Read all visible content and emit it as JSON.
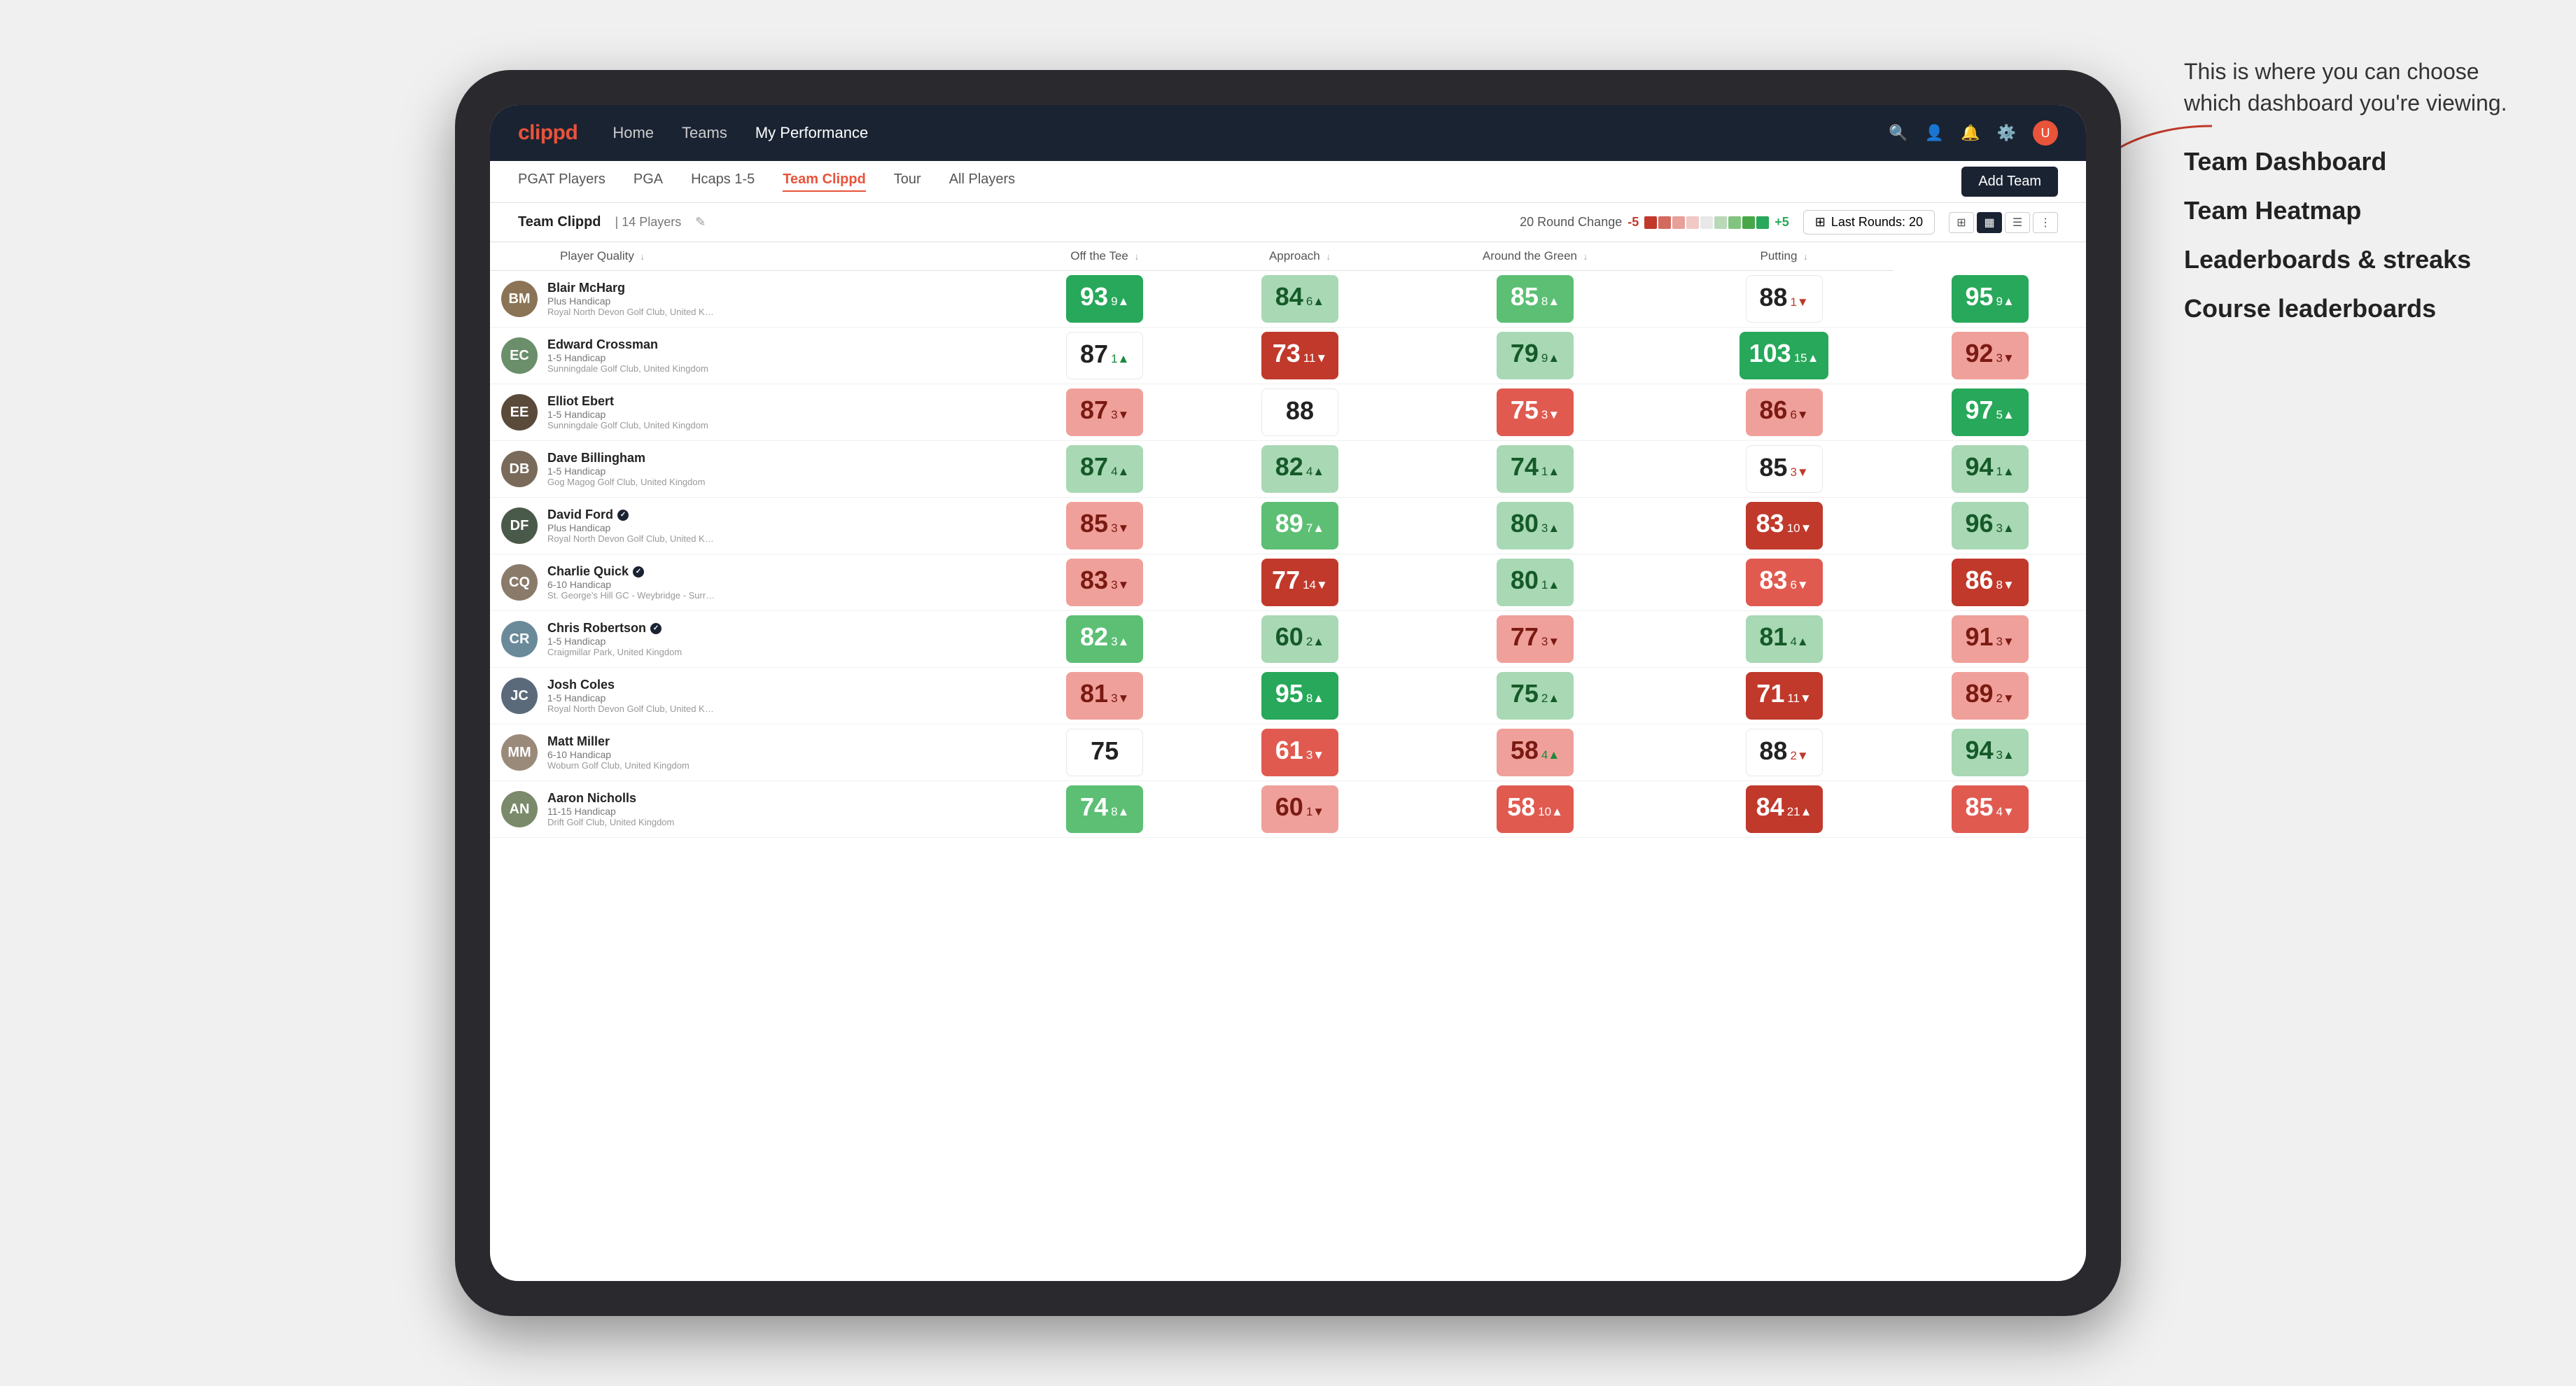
{
  "annotation": {
    "intro": "This is where you can choose which dashboard you're viewing.",
    "options": [
      "Team Dashboard",
      "Team Heatmap",
      "Leaderboards & streaks",
      "Course leaderboards"
    ]
  },
  "nav": {
    "logo": "clippd",
    "links": [
      "Home",
      "Teams",
      "My Performance"
    ],
    "active_link": "My Performance"
  },
  "sub_nav": {
    "links": [
      "PGAT Players",
      "PGA",
      "Hcaps 1-5",
      "Team Clippd",
      "Tour",
      "All Players"
    ],
    "active": "Team Clippd",
    "add_team_label": "Add Team"
  },
  "team_bar": {
    "name": "Team Clippd",
    "separator": "|",
    "count": "14 Players",
    "round_change_label": "20 Round Change",
    "delta_low": "-5",
    "delta_high": "+5",
    "last_rounds_label": "Last Rounds:",
    "last_rounds_value": "20"
  },
  "table": {
    "columns": [
      "Player Quality ↓",
      "Off the Tee ↓",
      "Approach ↓",
      "Around the Green ↓",
      "Putting ↓"
    ],
    "players": [
      {
        "name": "Blair McHarg",
        "hcp": "Plus Handicap",
        "club": "Royal North Devon Golf Club, United Kingdom",
        "initials": "BM",
        "color": "#8B7355",
        "scores": [
          {
            "val": "93",
            "delta": "9",
            "dir": "up",
            "color": "green-dark"
          },
          {
            "val": "84",
            "delta": "6",
            "dir": "up",
            "color": "green-light"
          },
          {
            "val": "85",
            "delta": "8",
            "dir": "up",
            "color": "green-mid"
          },
          {
            "val": "88",
            "delta": "1",
            "dir": "down",
            "color": "white"
          },
          {
            "val": "95",
            "delta": "9",
            "dir": "up",
            "color": "green-dark"
          }
        ]
      },
      {
        "name": "Edward Crossman",
        "hcp": "1-5 Handicap",
        "club": "Sunningdale Golf Club, United Kingdom",
        "initials": "EC",
        "color": "#6B8E6B",
        "scores": [
          {
            "val": "87",
            "delta": "1",
            "dir": "up",
            "color": "white"
          },
          {
            "val": "73",
            "delta": "11",
            "dir": "down",
            "color": "red-dark"
          },
          {
            "val": "79",
            "delta": "9",
            "dir": "up",
            "color": "green-light"
          },
          {
            "val": "103",
            "delta": "15",
            "dir": "up",
            "color": "green-dark"
          },
          {
            "val": "92",
            "delta": "3",
            "dir": "down",
            "color": "red-light"
          }
        ]
      },
      {
        "name": "Elliot Ebert",
        "hcp": "1-5 Handicap",
        "club": "Sunningdale Golf Club, United Kingdom",
        "initials": "EE",
        "color": "#5a4a3a",
        "scores": [
          {
            "val": "87",
            "delta": "3",
            "dir": "down",
            "color": "red-light"
          },
          {
            "val": "88",
            "delta": "",
            "dir": "neutral",
            "color": "white"
          },
          {
            "val": "75",
            "delta": "3",
            "dir": "down",
            "color": "red-mid"
          },
          {
            "val": "86",
            "delta": "6",
            "dir": "down",
            "color": "red-light"
          },
          {
            "val": "97",
            "delta": "5",
            "dir": "up",
            "color": "green-dark"
          }
        ]
      },
      {
        "name": "Dave Billingham",
        "hcp": "1-5 Handicap",
        "club": "Gog Magog Golf Club, United Kingdom",
        "initials": "DB",
        "color": "#7a6a5a",
        "scores": [
          {
            "val": "87",
            "delta": "4",
            "dir": "up",
            "color": "green-light"
          },
          {
            "val": "82",
            "delta": "4",
            "dir": "up",
            "color": "green-light"
          },
          {
            "val": "74",
            "delta": "1",
            "dir": "up",
            "color": "green-light"
          },
          {
            "val": "85",
            "delta": "3",
            "dir": "down",
            "color": "white"
          },
          {
            "val": "94",
            "delta": "1",
            "dir": "up",
            "color": "green-light"
          }
        ]
      },
      {
        "name": "David Ford",
        "hcp": "Plus Handicap",
        "club": "Royal North Devon Golf Club, United Kingdom",
        "initials": "DF",
        "verified": true,
        "color": "#4a5a4a",
        "scores": [
          {
            "val": "85",
            "delta": "3",
            "dir": "down",
            "color": "red-light"
          },
          {
            "val": "89",
            "delta": "7",
            "dir": "up",
            "color": "green-mid"
          },
          {
            "val": "80",
            "delta": "3",
            "dir": "up",
            "color": "green-light"
          },
          {
            "val": "83",
            "delta": "10",
            "dir": "down",
            "color": "red-dark"
          },
          {
            "val": "96",
            "delta": "3",
            "dir": "up",
            "color": "green-light"
          }
        ]
      },
      {
        "name": "Charlie Quick",
        "hcp": "6-10 Handicap",
        "club": "St. George's Hill GC - Weybridge - Surrey, Uni...",
        "initials": "CQ",
        "verified": true,
        "color": "#8a7a6a",
        "scores": [
          {
            "val": "83",
            "delta": "3",
            "dir": "down",
            "color": "red-light"
          },
          {
            "val": "77",
            "delta": "14",
            "dir": "down",
            "color": "red-dark"
          },
          {
            "val": "80",
            "delta": "1",
            "dir": "up",
            "color": "green-light"
          },
          {
            "val": "83",
            "delta": "6",
            "dir": "down",
            "color": "red-mid"
          },
          {
            "val": "86",
            "delta": "8",
            "dir": "down",
            "color": "red-dark"
          }
        ]
      },
      {
        "name": "Chris Robertson",
        "hcp": "1-5 Handicap",
        "club": "Craigmillar Park, United Kingdom",
        "initials": "CR",
        "verified": true,
        "color": "#6a8a9a",
        "scores": [
          {
            "val": "82",
            "delta": "3",
            "dir": "up",
            "color": "green-mid"
          },
          {
            "val": "60",
            "delta": "2",
            "dir": "up",
            "color": "green-light"
          },
          {
            "val": "77",
            "delta": "3",
            "dir": "down",
            "color": "red-light"
          },
          {
            "val": "81",
            "delta": "4",
            "dir": "up",
            "color": "green-light"
          },
          {
            "val": "91",
            "delta": "3",
            "dir": "down",
            "color": "red-light"
          }
        ]
      },
      {
        "name": "Josh Coles",
        "hcp": "1-5 Handicap",
        "club": "Royal North Devon Golf Club, United Kingdom",
        "initials": "JC",
        "color": "#5a6a7a",
        "scores": [
          {
            "val": "81",
            "delta": "3",
            "dir": "down",
            "color": "red-light"
          },
          {
            "val": "95",
            "delta": "8",
            "dir": "up",
            "color": "green-dark"
          },
          {
            "val": "75",
            "delta": "2",
            "dir": "up",
            "color": "green-light"
          },
          {
            "val": "71",
            "delta": "11",
            "dir": "down",
            "color": "red-dark"
          },
          {
            "val": "89",
            "delta": "2",
            "dir": "down",
            "color": "red-light"
          }
        ]
      },
      {
        "name": "Matt Miller",
        "hcp": "6-10 Handicap",
        "club": "Woburn Golf Club, United Kingdom",
        "initials": "MM",
        "color": "#9a8a7a",
        "scores": [
          {
            "val": "75",
            "delta": "",
            "dir": "neutral",
            "color": "white"
          },
          {
            "val": "61",
            "delta": "3",
            "dir": "down",
            "color": "red-mid"
          },
          {
            "val": "58",
            "delta": "4",
            "dir": "up",
            "color": "red-light"
          },
          {
            "val": "88",
            "delta": "2",
            "dir": "down",
            "color": "white"
          },
          {
            "val": "94",
            "delta": "3",
            "dir": "up",
            "color": "green-light"
          }
        ]
      },
      {
        "name": "Aaron Nicholls",
        "hcp": "11-15 Handicap",
        "club": "Drift Golf Club, United Kingdom",
        "initials": "AN",
        "color": "#7a8a6a",
        "scores": [
          {
            "val": "74",
            "delta": "8",
            "dir": "up",
            "color": "green-mid"
          },
          {
            "val": "60",
            "delta": "1",
            "dir": "down",
            "color": "red-light"
          },
          {
            "val": "58",
            "delta": "10",
            "dir": "up",
            "color": "red-mid"
          },
          {
            "val": "84",
            "delta": "21",
            "dir": "up",
            "color": "red-dark"
          },
          {
            "val": "85",
            "delta": "4",
            "dir": "down",
            "color": "red-mid"
          }
        ]
      }
    ]
  }
}
